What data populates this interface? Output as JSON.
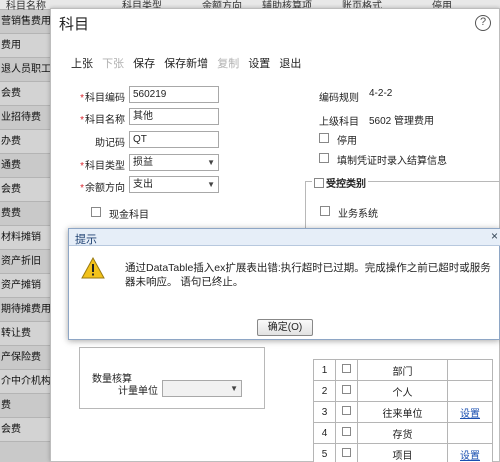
{
  "background": {
    "header_columns": [
      "科目名称",
      "科目类型",
      "余额方向",
      "辅助核算项",
      "账页格式",
      "停用"
    ],
    "rows": [
      "营销售费用",
      "费用",
      "退人员职工",
      "会费",
      "业招待费",
      "办费",
      "通费",
      "会费",
      "费费",
      "材料摊销",
      "资产折旧",
      "资产摊销",
      "期待摊费用",
      "转让费",
      "产保险费",
      "介中介机构",
      "费",
      "会费"
    ]
  },
  "dialog": {
    "title": "科目",
    "help_icon_glyph": "?",
    "toolbar": {
      "prev": "上张",
      "next": "下张",
      "save": "保存",
      "save_new": "保存新增",
      "copy": "复制",
      "settings": "设置",
      "exit": "退出"
    },
    "form": {
      "required_mark": "*",
      "code_label": "科目编码",
      "code_value": "560219",
      "name_label": "科目名称",
      "name_value": "其他",
      "mnemonic_label": "助记码",
      "mnemonic_value": "QT",
      "type_label": "科目类型",
      "type_value": "损益",
      "direction_label": "余额方向",
      "direction_value": "支出",
      "cash_subject_label": "现金科目",
      "chevron_glyph": "▼"
    },
    "right_info": {
      "code_rule_label": "编码规则",
      "code_rule_value": "4-2-2",
      "parent_label": "上级科目",
      "parent_value": "5602 管理费用",
      "disabled_label": "停用",
      "voucher_settle_label": "填制凭证时录入结算信息"
    },
    "control": {
      "legend": "受控类别",
      "business_system_label": "业务系统"
    },
    "quantity": {
      "legend": "数量核算",
      "unit_label": "计量单位"
    },
    "aux_table": {
      "rows": [
        {
          "no": "1",
          "name": "部门",
          "action": ""
        },
        {
          "no": "2",
          "name": "个人",
          "action": ""
        },
        {
          "no": "3",
          "name": "往来单位",
          "action": "设置"
        },
        {
          "no": "4",
          "name": "存货",
          "action": ""
        },
        {
          "no": "5",
          "name": "项目",
          "action": "设置"
        }
      ]
    }
  },
  "popup": {
    "title": "提示",
    "close_glyph": "×",
    "message": "通过DataTable插入ex扩展表出错:执行超时已过期。完成操作之前已超时或服务器未响应。 语句已终止。",
    "ok_label": "确定(O)",
    "warning_color": "#f2c21b"
  }
}
